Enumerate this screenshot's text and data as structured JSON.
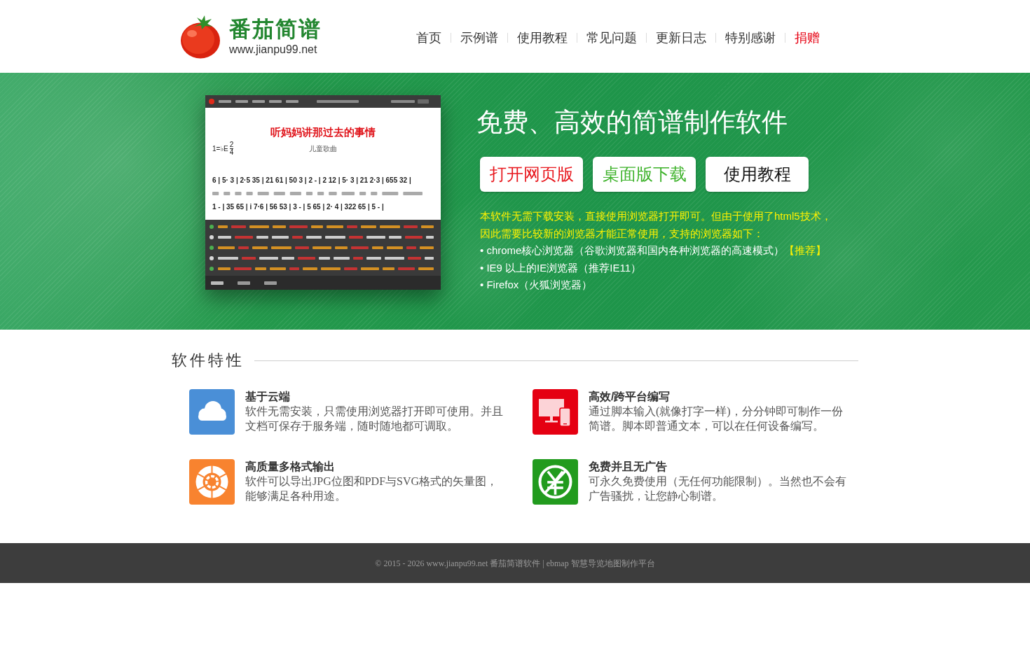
{
  "header": {
    "logo": {
      "title": "番茄简谱",
      "url": "www.jianpu99.net"
    },
    "nav": [
      {
        "label": "首页",
        "highlight": false
      },
      {
        "label": "示例谱",
        "highlight": false
      },
      {
        "label": "使用教程",
        "highlight": false
      },
      {
        "label": "常见问题",
        "highlight": false
      },
      {
        "label": "更新日志",
        "highlight": false
      },
      {
        "label": "特别感谢",
        "highlight": false
      },
      {
        "label": "捐赠",
        "highlight": true
      }
    ]
  },
  "hero": {
    "app_preview": {
      "song_title": "听妈妈讲那过去的事情",
      "song_subtitle": "儿童歌曲",
      "key": "1=♭E",
      "time_signature": {
        "upper": "2",
        "lower": "4"
      },
      "notation": [
        "6 | 5· 3 | 2·5 35 | 21 61 | 50 3 | 2 - | 2 12 | 5· 3 | 21 2·3 | 655 32 |",
        "1 - | 35 65 | i 7·6 | 56 53 | 3 - | 5 65 | 2· 4 | 322 65 | 5 - |"
      ]
    },
    "headline": "免费、高效的简谱制作软件",
    "buttons": [
      {
        "label": "打开网页版",
        "color": "#e8161c"
      },
      {
        "label": "桌面版下载",
        "color": "#3db22a"
      },
      {
        "label": "使用教程",
        "color": "#111111"
      }
    ],
    "notice": "本软件无需下载安装，直接使用浏览器打开即可。但由于使用了html5技术，因此需要比较新的浏览器才能正常使用，支持的浏览器如下：",
    "browsers": [
      {
        "text": "• chrome核心浏览器（谷歌浏览器和国内各种浏览器的高速模式）",
        "tag": "【推荐】"
      },
      {
        "text": "• IE9 以上的IE浏览器（推荐IE11）"
      },
      {
        "text": "• Firefox（火狐浏览器）"
      }
    ]
  },
  "features": {
    "title": "软件特性",
    "items": [
      {
        "kind": "cloud",
        "title": "基于云端",
        "text": "软件无需安装，只需使用浏览器打开即可使用。并且文档可保存于服务端，随时随地都可调取。"
      },
      {
        "kind": "devices",
        "title": "高效/跨平台编写",
        "text": "通过脚本输入(就像打字一样)，分分钟即可制作一份简谱。脚本即普通文本，可以在任何设备编写。"
      },
      {
        "kind": "export",
        "title": "高质量多格式输出",
        "text": "软件可以导出JPG位图和PDF与SVG格式的矢量图，能够满足各种用途。"
      },
      {
        "kind": "free",
        "title": "免费并且无广告",
        "text": "可永久免费使用（无任何功能限制）。当然也不会有广告骚扰，让您静心制谱。"
      }
    ]
  },
  "footer": {
    "copyright": "© 2015 - 2026 www.jianpu99.net 番茄简谱软件 | ebmap 智慧导览地图制作平台"
  }
}
